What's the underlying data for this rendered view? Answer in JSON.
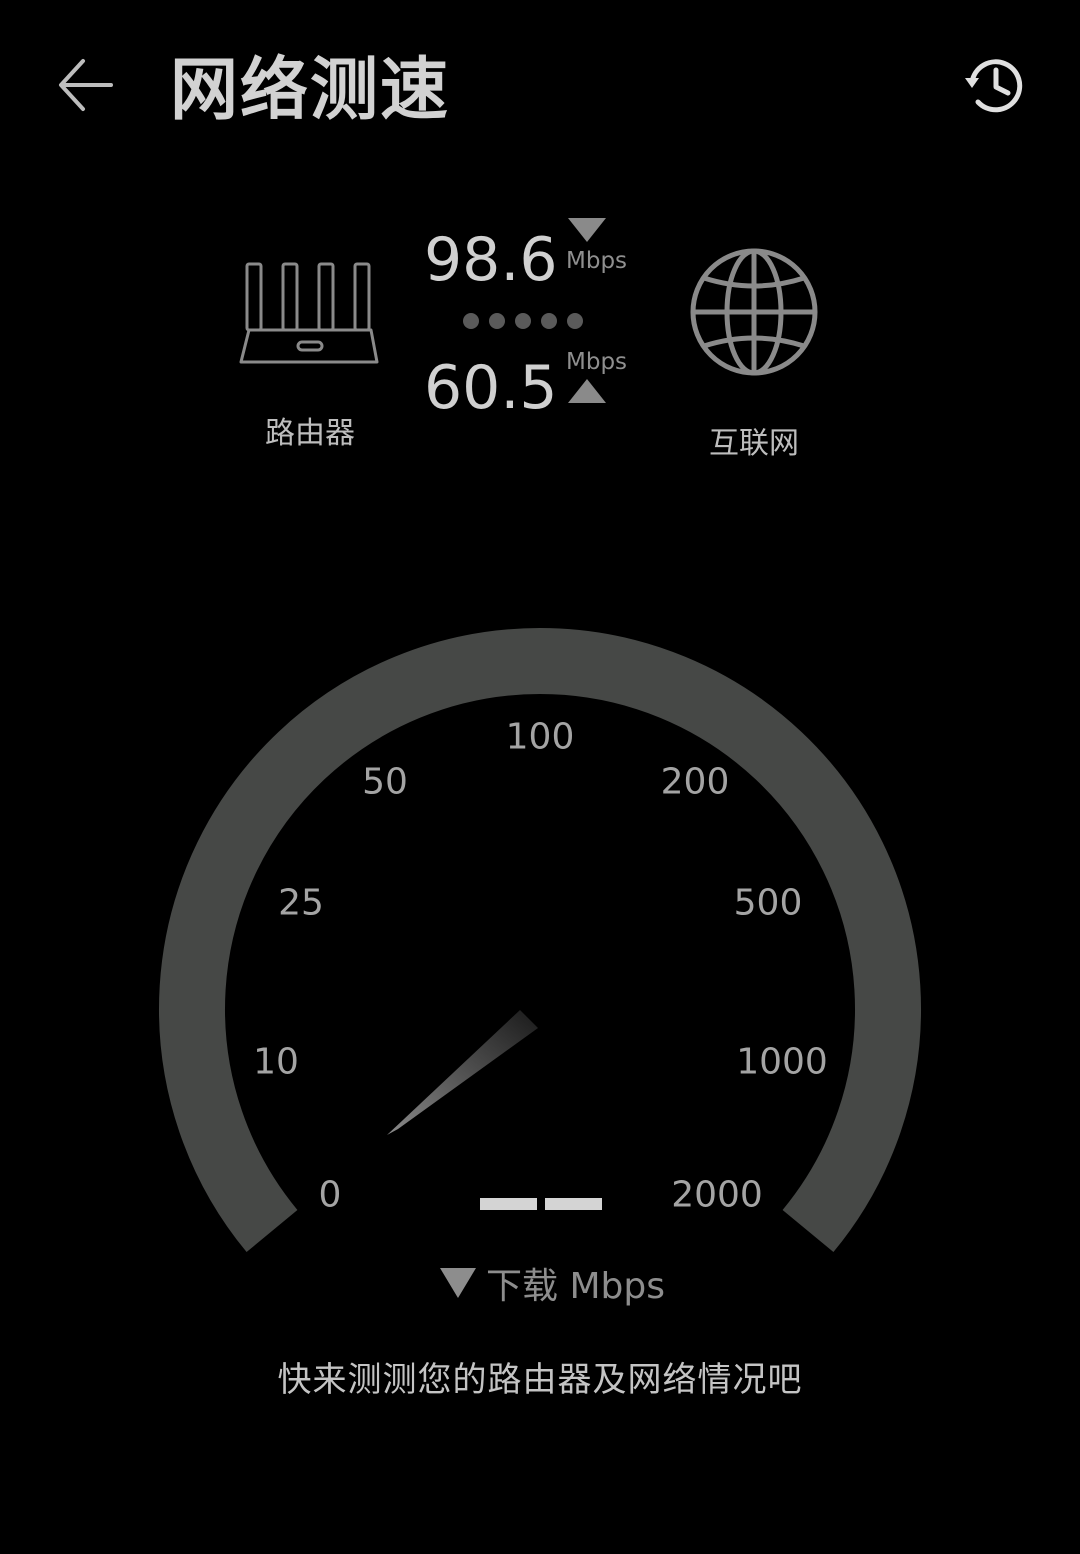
{
  "header": {
    "title": "网络测速",
    "back_icon": "back-arrow-icon",
    "history_icon": "history-clock-icon"
  },
  "status": {
    "router_label": "路由器",
    "internet_label": "互联网",
    "download_value": "98.6",
    "download_unit": "Mbps",
    "upload_value": "60.5",
    "upload_unit": "Mbps",
    "router_icon": "router-icon",
    "globe_icon": "globe-icon"
  },
  "gauge": {
    "ticks": [
      "0",
      "10",
      "25",
      "50",
      "100",
      "200",
      "500",
      "1000",
      "2000"
    ],
    "reading": "——",
    "caption_unit": "下载 Mbps",
    "needle_value": 0
  },
  "footer": {
    "hint": "快来测测您的路由器及网络情况吧"
  },
  "colors": {
    "background": "#000000",
    "gauge_track": "#464846",
    "text_primary": "#d0d0d0",
    "text_secondary": "#8d8d8d"
  }
}
